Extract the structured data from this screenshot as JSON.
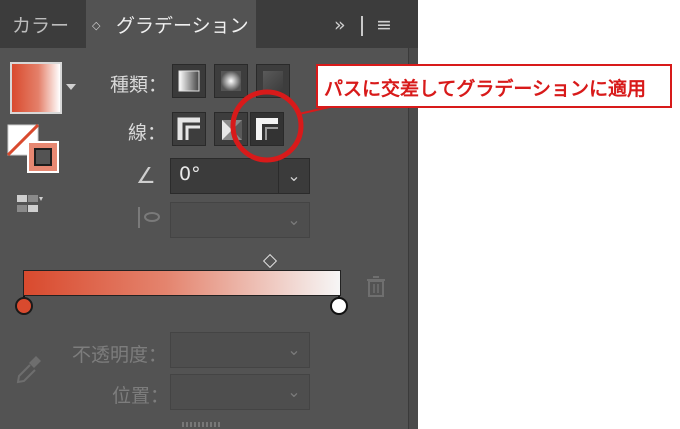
{
  "tabs": {
    "color_label": "カラー",
    "gradient_label": "グラデーション",
    "updown_glyph": "◇",
    "more_glyph": "»",
    "menu_glyph": "≡"
  },
  "type": {
    "label": "種類：",
    "options": [
      "linear-gradient-icon",
      "radial-gradient-icon",
      "freeform-gradient-icon"
    ]
  },
  "stroke": {
    "label": "線：",
    "options": [
      "apply-within-stroke-icon",
      "apply-along-stroke-icon",
      "apply-across-stroke-icon"
    ],
    "selected": "apply-across-stroke-icon"
  },
  "angle": {
    "value": "0°",
    "glyph": "∠"
  },
  "aspect": {
    "value": ""
  },
  "stops": {
    "left_color": "#d94a2e",
    "right_color": "#ffffff",
    "midpoint": 0.79
  },
  "opacity": {
    "label": "不透明度：",
    "value": ""
  },
  "location": {
    "label": "位置：",
    "value": ""
  },
  "annotation": {
    "text": "パスに交差してグラデーションに適用",
    "color": "#d81a1a"
  },
  "colors": {
    "panel": "#535353",
    "tabbar": "#3c3c3c",
    "accent": "#d94a2e"
  }
}
